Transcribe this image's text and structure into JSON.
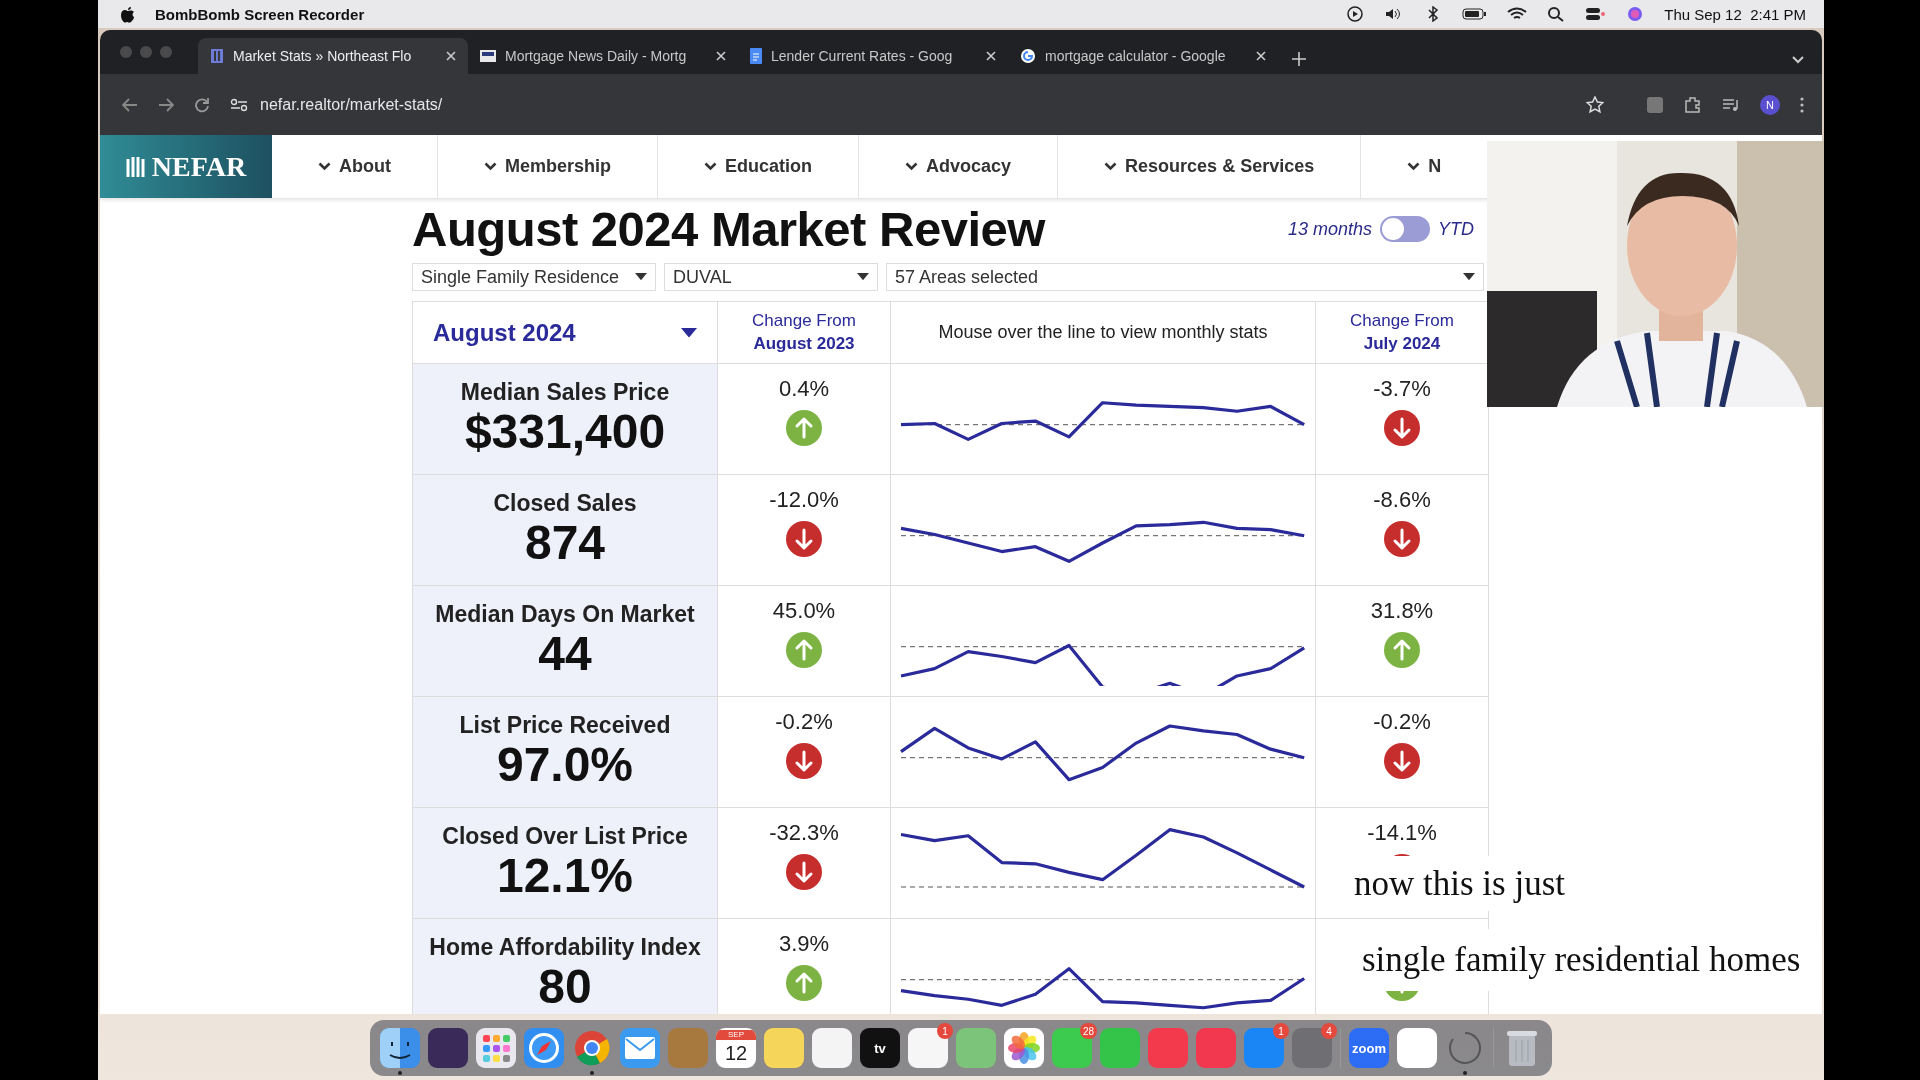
{
  "menu_bar": {
    "app_name": "BombBomb Screen Recorder",
    "clock": "Thu Sep 12  2:41 PM"
  },
  "browser": {
    "tabs": [
      {
        "title": "Market Stats » Northeast Flo",
        "selected": true
      },
      {
        "title": "Mortgage News Daily - Mortg",
        "selected": false
      },
      {
        "title": "Lender Current Rates - Goog",
        "selected": false
      },
      {
        "title": "mortgage calculator - Google",
        "selected": false
      }
    ],
    "url": "nefar.realtor/market-stats/",
    "profile": "N"
  },
  "site": {
    "logo": "NEFAR",
    "nav": [
      "About",
      "Membership",
      "Education",
      "Advocacy",
      "Resources & Services",
      "N"
    ]
  },
  "report": {
    "title": "August 2024 Market Review",
    "toggle": {
      "left_label": "13 months",
      "right_label": "YTD",
      "on": false
    },
    "filters": [
      "Single Family Residence",
      "DUVAL",
      "57 Areas selected"
    ],
    "header": {
      "period": "August 2024",
      "change_1": [
        "Change From",
        "August 2023"
      ],
      "hint": "Mouse over the line to view monthly stats",
      "change_2": [
        "Change From",
        "July 2024"
      ]
    },
    "rows": [
      {
        "name": "Median Sales Price",
        "value": "$331,400",
        "change_1": {
          "value": "0.4%",
          "up": true
        },
        "change_2": {
          "value": "-3.7%",
          "up": false
        }
      },
      {
        "name": "Closed Sales",
        "value": "874",
        "change_1": {
          "value": "-12.0%",
          "up": false
        },
        "change_2": {
          "value": "-8.6%",
          "up": false
        }
      },
      {
        "name": "Median Days On Market",
        "value": "44",
        "change_1": {
          "value": "45.0%",
          "up": true
        },
        "change_2": {
          "value": "31.8%",
          "up": true
        }
      },
      {
        "name": "List Price Received",
        "value": "97.0%",
        "change_1": {
          "value": "-0.2%",
          "up": false
        },
        "change_2": {
          "value": "-0.2%",
          "up": false
        }
      },
      {
        "name": "Closed Over List Price",
        "value": "12.1%",
        "change_1": {
          "value": "-32.3%",
          "up": false
        },
        "change_2": {
          "value": "-14.1%",
          "up": false
        }
      },
      {
        "name": "Home Affordability Index",
        "value": "80",
        "change_1": {
          "value": "3.9%",
          "up": true
        },
        "change_2": {
          "up": true
        }
      }
    ]
  },
  "webcam": {
    "kind": "picture"
  },
  "captions": [
    "now this is just",
    "single family residential homes"
  ],
  "dock": [
    {
      "kind": "finder",
      "running": true
    },
    {
      "kind": "app",
      "running": false
    },
    {
      "kind": "grid",
      "running": false
    },
    {
      "kind": "compass",
      "running": false
    },
    {
      "kind": "chrome",
      "running": true
    },
    {
      "kind": "mail",
      "running": false
    },
    {
      "kind": "app",
      "running": false
    },
    {
      "kind": "calendar",
      "label": "SEP",
      "sub_label": "12",
      "running": false
    },
    {
      "kind": "app",
      "running": false
    },
    {
      "kind": "app",
      "running": false
    },
    {
      "kind": "text",
      "label": "tv",
      "running": false
    },
    {
      "kind": "app",
      "badge": "1",
      "running": false
    },
    {
      "kind": "app",
      "running": false
    },
    {
      "kind": "photos",
      "running": false
    },
    {
      "kind": "app",
      "badge": "28",
      "running": false
    },
    {
      "kind": "app",
      "running": false
    },
    {
      "kind": "app",
      "running": false
    },
    {
      "kind": "app",
      "running": false
    },
    {
      "kind": "app",
      "badge": "1",
      "running": false
    },
    {
      "kind": "app",
      "badge": "4",
      "running": false
    },
    {
      "kind": "separator"
    },
    {
      "kind": "text",
      "label": "zoom",
      "running": false
    },
    {
      "kind": "app",
      "running": false
    },
    {
      "kind": "spinner",
      "running": true
    },
    {
      "kind": "separator"
    },
    {
      "kind": "trash",
      "running": false
    }
  ]
}
